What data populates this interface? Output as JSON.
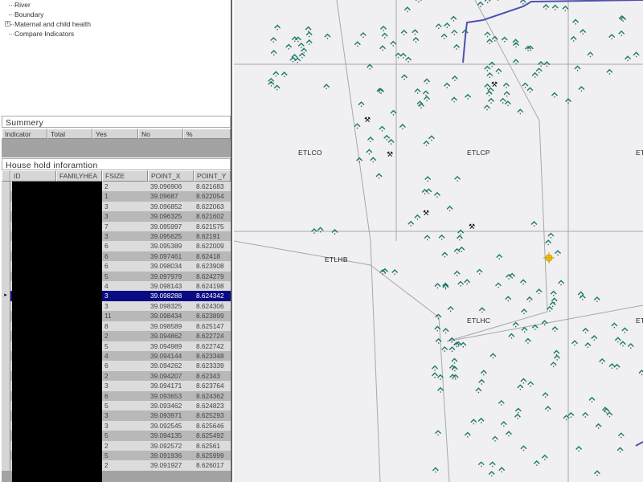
{
  "tree": {
    "items": [
      {
        "label": "River",
        "expandable": false
      },
      {
        "label": "Boundary",
        "expandable": false
      },
      {
        "label": "Maternal and child health",
        "expandable": true
      },
      {
        "label": "Compare Indicators",
        "expandable": false
      }
    ]
  },
  "summary": {
    "title": "Summery",
    "columns": [
      "Indicator",
      "Total",
      "Yes",
      "No",
      "%"
    ]
  },
  "household": {
    "title": "House hold inforamtion",
    "columns": [
      "ID",
      "FAMILYHEA",
      "FSIZE",
      "POINT_X",
      "POINT_Y"
    ],
    "selected_index": 11,
    "rows": [
      [
        "2",
        "39.096906",
        "8.621683"
      ],
      [
        "1",
        "39.09687",
        "8.622054"
      ],
      [
        "3",
        "39.096852",
        "8.622063"
      ],
      [
        "3",
        "39.096325",
        "8.621602"
      ],
      [
        "7",
        "39.095997",
        "8.621575"
      ],
      [
        "3",
        "39.095625",
        "8.62191"
      ],
      [
        "6",
        "39.095389",
        "8.622009"
      ],
      [
        "6",
        "39.097461",
        "8.62418"
      ],
      [
        "6",
        "39.098034",
        "8.623908"
      ],
      [
        "5",
        "39.097979",
        "8.624279"
      ],
      [
        "4",
        "39.098143",
        "8.624198"
      ],
      [
        "3",
        "39.098288",
        "8.624342"
      ],
      [
        "3",
        "39.098325",
        "8.624306"
      ],
      [
        "11",
        "39.098434",
        "8.623899"
      ],
      [
        "8",
        "39.098589",
        "8.625147"
      ],
      [
        "2",
        "39.094862",
        "8.622724"
      ],
      [
        "5",
        "39.094989",
        "8.622742"
      ],
      [
        "4",
        "39.094144",
        "8.623348"
      ],
      [
        "6",
        "39.094262",
        "8.623339"
      ],
      [
        "2",
        "39.094207",
        "8.62343"
      ],
      [
        "3",
        "39.094171",
        "8.623764"
      ],
      [
        "6",
        "39.093653",
        "8.624362"
      ],
      [
        "5",
        "39.093462",
        "8.624823"
      ],
      [
        "3",
        "39.093971",
        "8.625293"
      ],
      [
        "3",
        "39.092545",
        "8.625646"
      ],
      [
        "5",
        "39.094135",
        "8.625492"
      ],
      [
        "2",
        "39.092572",
        "8.62561"
      ],
      [
        "5",
        "39.091936",
        "8.625999"
      ],
      [
        "2",
        "39.091927",
        "8.626017"
      ]
    ]
  },
  "map": {
    "labels": [
      "ETLCO",
      "ETLCP",
      "ET",
      "ETLHB",
      "ETLHC",
      "ET"
    ],
    "colors": {
      "house": "#1a7a6a",
      "river": "#5050b0",
      "road": "#999999",
      "background": "#f0f0f3",
      "selected_marker": "#f5d000"
    }
  }
}
